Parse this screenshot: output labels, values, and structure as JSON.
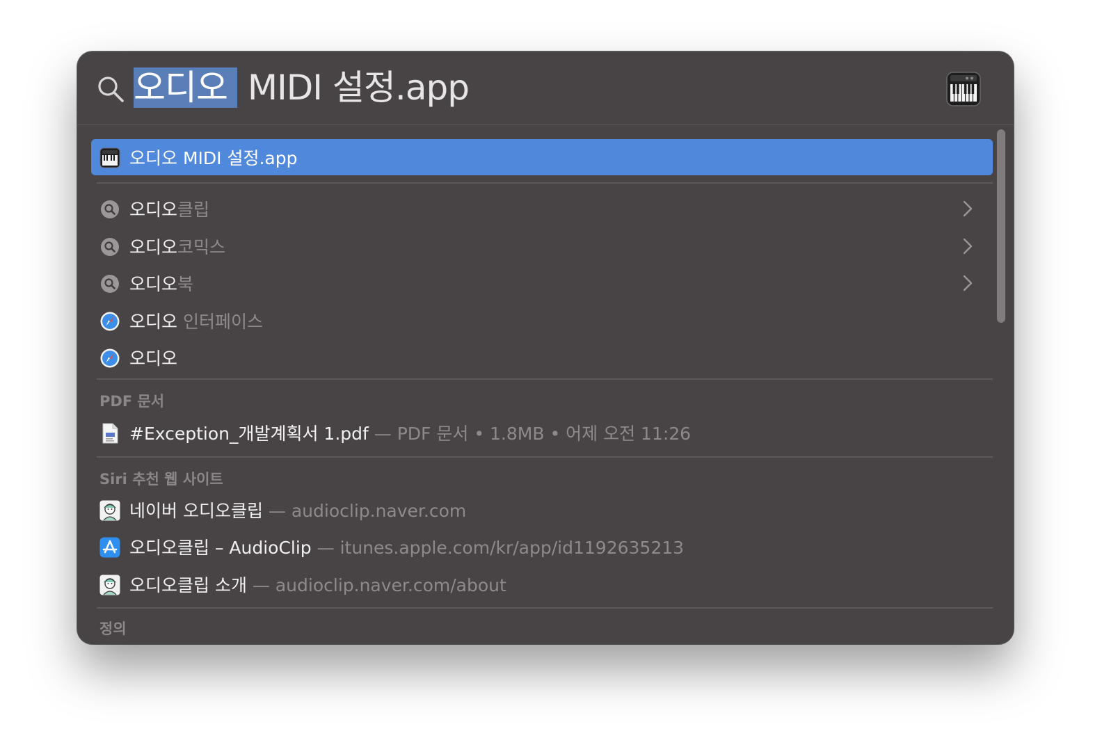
{
  "search": {
    "query_selected": "오디오",
    "query_rest": " MIDI 설정.app"
  },
  "top_hit": {
    "label": "오디오 MIDI 설정.app",
    "icon": "piano-keyboard-icon"
  },
  "suggestions": [
    {
      "typed": "오디오",
      "completion": "클립",
      "icon": "search-suggestion-icon",
      "has_chevron": true
    },
    {
      "typed": "오디오",
      "completion": "코믹스",
      "icon": "search-suggestion-icon",
      "has_chevron": true
    },
    {
      "typed": "오디오",
      "completion": "북",
      "icon": "search-suggestion-icon",
      "has_chevron": true
    },
    {
      "typed": "오디오",
      "completion": " 인터페이스",
      "icon": "safari-icon",
      "has_chevron": false
    },
    {
      "typed": "오디오",
      "completion": "",
      "icon": "safari-icon",
      "has_chevron": false
    }
  ],
  "pdf_section": {
    "title": "PDF 문서",
    "items": [
      {
        "name": "#Exception_개발계획서 1.pdf",
        "detail": " — PDF 문서 • 1.8MB • 어제 오전 11:26",
        "icon": "pdf-document-icon"
      }
    ]
  },
  "siri_section": {
    "title": "Siri 추천 웹 사이트",
    "items": [
      {
        "name": "네이버 오디오클립",
        "detail": " — audioclip.naver.com",
        "icon": "audioclip-avatar-icon"
      },
      {
        "name": "오디오클립 – AudioClip",
        "detail": " — itunes.apple.com/kr/app/id1192635213",
        "icon": "app-store-icon"
      },
      {
        "name": "오디오클립 소개",
        "detail": " — audioclip.naver.com/about",
        "icon": "audioclip-avatar-icon"
      }
    ]
  },
  "definition_section": {
    "title": "정의"
  },
  "colors": {
    "panel_bg": "#484445",
    "selection": "#5088dc",
    "text_primary": "#f2f0f1",
    "text_dim": "#8e8a8b"
  }
}
